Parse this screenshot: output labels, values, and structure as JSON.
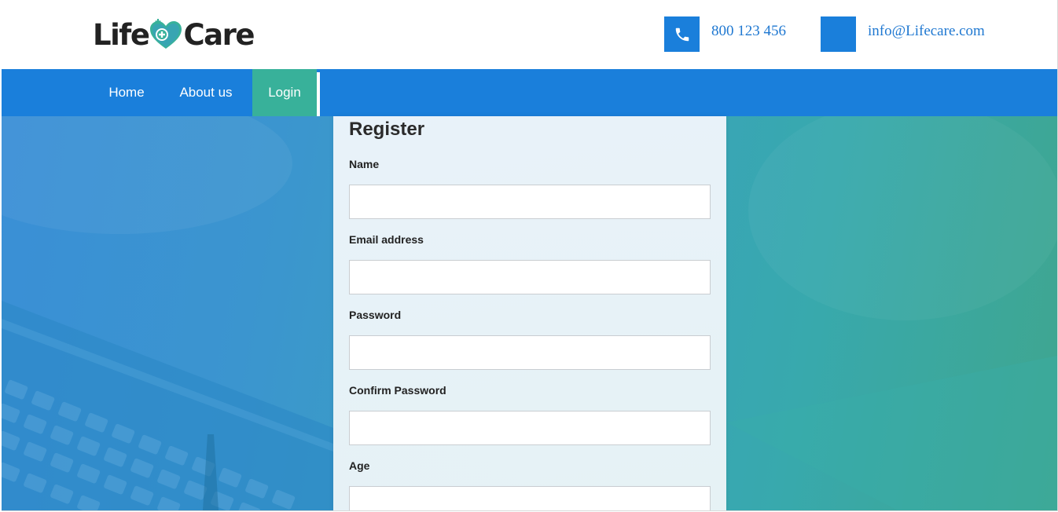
{
  "brand": {
    "logo_part1": "Life",
    "logo_part2": "Care",
    "primary_color": "#1a7fdb",
    "accent_color": "#38b19a"
  },
  "header": {
    "phone": {
      "icon": "phone-icon",
      "text": "800 123 456"
    },
    "email": {
      "icon": "email-icon",
      "text": "info@Lifecare.com"
    }
  },
  "nav": {
    "items": [
      {
        "label": "Home",
        "active": false
      },
      {
        "label": "About us",
        "active": false
      },
      {
        "label": "Login",
        "active": true
      }
    ]
  },
  "register_form": {
    "title": "Register",
    "fields": [
      {
        "label": "Name",
        "value": "",
        "type": "text"
      },
      {
        "label": "Email address",
        "value": "",
        "type": "email"
      },
      {
        "label": "Password",
        "value": "",
        "type": "password"
      },
      {
        "label": "Confirm Password",
        "value": "",
        "type": "password"
      },
      {
        "label": "Age",
        "value": "",
        "type": "text"
      }
    ]
  }
}
